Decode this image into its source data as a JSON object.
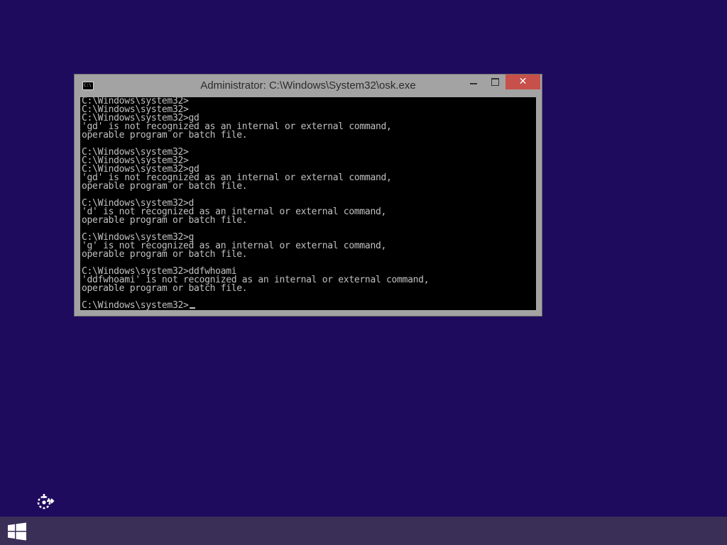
{
  "window": {
    "title": "Administrator: C:\\Windows\\System32\\osk.exe",
    "icon": "console-icon",
    "icon_text": "C:\\",
    "controls": {
      "minimize_icon": "minimize-icon",
      "maximize_icon": "maximize-icon",
      "close_icon": "close-icon",
      "close_glyph": "✕"
    }
  },
  "console": {
    "lines": [
      "C:\\Windows\\system32>",
      "C:\\Windows\\system32>",
      "C:\\Windows\\system32>gd",
      "'gd' is not recognized as an internal or external command,",
      "operable program or batch file.",
      "",
      "C:\\Windows\\system32>",
      "C:\\Windows\\system32>",
      "C:\\Windows\\system32>gd",
      "'gd' is not recognized as an internal or external command,",
      "operable program or batch file.",
      "",
      "C:\\Windows\\system32>d",
      "'d' is not recognized as an internal or external command,",
      "operable program or batch file.",
      "",
      "C:\\Windows\\system32>g",
      "'g' is not recognized as an internal or external command,",
      "operable program or batch file.",
      "",
      "C:\\Windows\\system32>ddfwhoami",
      "'ddfwhoami' is not recognized as an internal or external command,",
      "operable program or batch file.",
      ""
    ],
    "prompt": "C:\\Windows\\system32>"
  },
  "desktop": {
    "ease_of_access_icon": "ease-of-access-icon"
  },
  "taskbar": {
    "start_icon": "windows-logo-icon"
  },
  "colors": {
    "desktop_background": "#1e0b5e",
    "taskbar": "#3a2f57",
    "window_frame": "#a3a3a3",
    "close_button": "#c7504b",
    "console_background": "#000000",
    "console_text": "#c0c0c0"
  }
}
